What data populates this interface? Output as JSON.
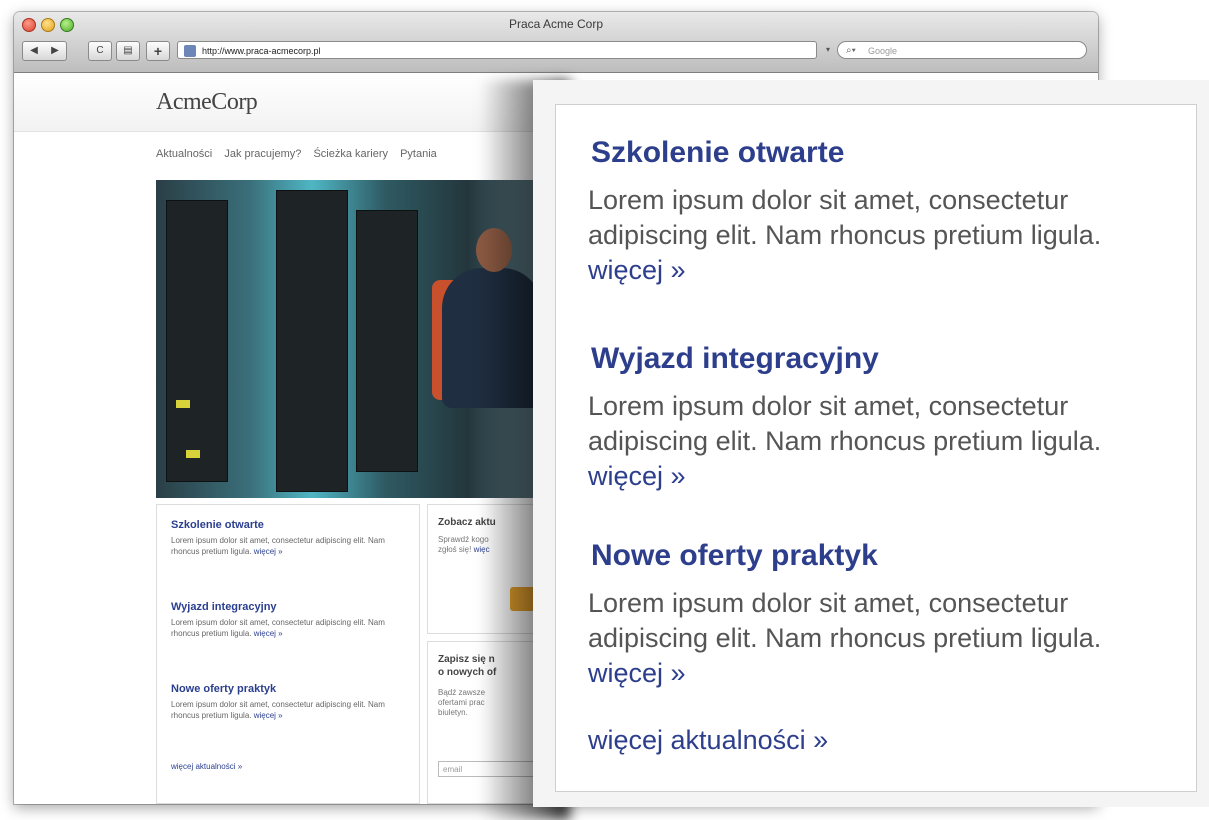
{
  "window": {
    "title": "Praca Acme Corp"
  },
  "toolbar": {
    "back_icon": "◀",
    "forward_icon": "▶",
    "reload_icon": "C",
    "rss_icon": "▤",
    "add_icon": "+",
    "url": "http://www.praca-acmecorp.pl",
    "search_placeholder": "Google"
  },
  "site": {
    "logo": "AcmeCorp",
    "nav": [
      "Aktualności",
      "Jak pracujemy?",
      "Ścieżka kariery",
      "Pytania"
    ]
  },
  "news": {
    "items": [
      {
        "title": "Szkolenie otwarte",
        "text": "Lorem ipsum dolor sit amet, consectetur adipiscing elit. Nam rhoncus pretium ligula.",
        "more": "więcej »"
      },
      {
        "title": "Wyjazd integracyjny",
        "text": "Lorem ipsum dolor sit amet, consectetur adipiscing elit. Nam rhoncus pretium ligula.",
        "more": "więcej »"
      },
      {
        "title": "Nowe oferty praktyk",
        "text": "Lorem ipsum dolor sit amet, consectetur adipiscing elit. Nam rhoncus pretium ligula.",
        "more": "więcej »"
      }
    ],
    "all_link": "więcej aktualności »"
  },
  "middle": {
    "box1_title": "Zobacz aktu",
    "box1_line1": "Sprawdź kogo",
    "box1_line2": "zgłoś się!",
    "box1_link": "więc",
    "box2_title_1": "Zapisz się n",
    "box2_title_2": "o nowych of",
    "box2_line1": "Bądź zawsze",
    "box2_line2": "ofertami prac",
    "box2_line3": "biuletyn.",
    "email_placeholder": "email"
  },
  "colors": {
    "link": "#2d3f8c",
    "button": "#e7a32e"
  }
}
